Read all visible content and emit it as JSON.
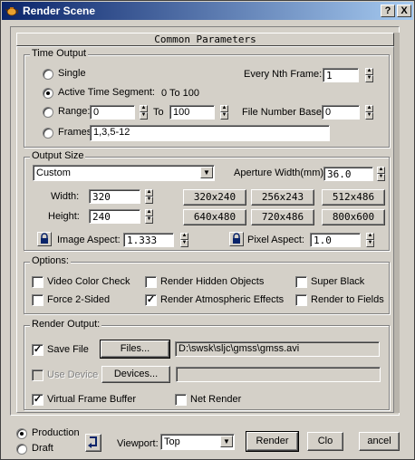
{
  "window": {
    "title": "Render Scene",
    "help_label": "?",
    "close_label": "X"
  },
  "rollout": {
    "title": "Common Parameters"
  },
  "time_output": {
    "title": "Time Output",
    "single_label": "Single",
    "every_nth_label": "Every Nth Frame:",
    "every_nth_value": "1",
    "active_segment_label": "Active Time Segment:",
    "active_segment_range": "0 To 100",
    "range_label": "Range:",
    "range_from": "0",
    "range_to_label": "To",
    "range_to": "100",
    "file_number_base_label": "File Number Base:",
    "file_number_base_value": "0",
    "frames_label": "Frames",
    "frames_value": "1,3,5-12",
    "selected": "active_segment"
  },
  "output_size": {
    "title": "Output Size",
    "preset": "Custom",
    "aperture_label": "Aperture Width(mm):",
    "aperture_value": "36.0",
    "width_label": "Width:",
    "width_value": "320",
    "height_label": "Height:",
    "height_value": "240",
    "resolution_buttons": [
      "320x240",
      "256x243",
      "512x486",
      "640x480",
      "720x486",
      "800x600"
    ],
    "image_aspect_label": "Image Aspect:",
    "image_aspect_value": "1.333",
    "pixel_aspect_label": "Pixel Aspect:",
    "pixel_aspect_value": "1.0"
  },
  "options": {
    "title": "Options:",
    "video_color_check": {
      "label": "Video Color Check",
      "checked": false
    },
    "render_hidden_objects": {
      "label": "Render Hidden Objects",
      "checked": false
    },
    "super_black": {
      "label": "Super Black",
      "checked": false
    },
    "force_2_sided": {
      "label": "Force 2-Sided",
      "checked": false
    },
    "render_atmospheric_effects": {
      "label": "Render Atmospheric Effects",
      "checked": true
    },
    "render_to_fields": {
      "label": "Render to Fields",
      "checked": false
    }
  },
  "render_output": {
    "title": "Render Output:",
    "save_file_label": "Save File",
    "save_file_checked": true,
    "files_button": "Files...",
    "file_path": "D:\\swsk\\sljc\\gmss\\gmss.avi",
    "use_device_label": "Use Device",
    "devices_button": "Devices...",
    "virtual_frame_buffer_label": "Virtual Frame Buffer",
    "virtual_frame_buffer_checked": true,
    "net_render_label": "Net Render",
    "net_render_checked": false
  },
  "footer": {
    "production_label": "Production",
    "draft_label": "Draft",
    "viewport_label": "Viewport:",
    "viewport_value": "Top",
    "render_button": "Render",
    "close_button": "Clo",
    "cancel_button": "ancel"
  },
  "icons": {
    "app": "teapot-icon",
    "swap": "swap-arrow-icon",
    "lock": "lock-icon"
  },
  "colors": {
    "titlebar_start": "#0a246a",
    "titlebar_end": "#a6caf0",
    "face": "#d4d0c8"
  }
}
